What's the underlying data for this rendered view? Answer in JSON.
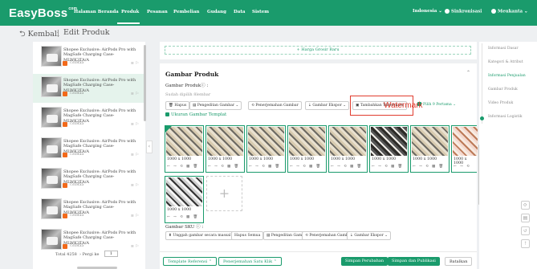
{
  "topnav": {
    "logo": "EasyBoss",
    "logo_sup": "com",
    "items": [
      "Halaman Beranda",
      "Produk",
      "Pesanan",
      "Pembelian",
      "Gudang",
      "Data",
      "Sistem"
    ],
    "language": "Indonesia",
    "sync": "Sinkronisasi",
    "user": "Meukanta"
  },
  "header": {
    "back_label": "Kembali",
    "title": "Edit Produk"
  },
  "product_list": {
    "items": [
      {
        "name": "Shopee Exclusive: AirPods Pro with MagSafe Charging Case-MLWK3TA/A",
        "code": "731855"
      },
      {
        "name": "Shopee Exclusive: AirPods Pro with MagSafe Charging Case-MLWK3TA/A",
        "code": "731855"
      },
      {
        "name": "Shopee Exclusive: AirPods Pro with MagSafe Charging Case-MLWK3TA/A",
        "code": "731855"
      },
      {
        "name": "Shopee Exclusive: AirPods Pro with MagSafe Charging Case-MLWK3TA/A",
        "code": "731855"
      },
      {
        "name": "Shopee Exclusive: AirPods Pro with MagSafe Charging Case-MLWK3TA/A",
        "code": "731855"
      },
      {
        "name": "Shopee Exclusive: AirPods Pro with MagSafe Charging Case-MLWK3TA/A",
        "code": "731855"
      },
      {
        "name": "Shopee Exclusive: AirPods Pro with MagSafe Charging Case-MLWK3TA/A",
        "code": "731855"
      }
    ],
    "total": "Total 4258",
    "goto": "Pergi ke",
    "page": "1"
  },
  "variant": {
    "add_label": "+ Harga Grosir Baru"
  },
  "images_section": {
    "title": "Gambar Produk",
    "product_images_label": "Gambar Produkⓘ :",
    "hint": "Sudah dipilih 8lembar",
    "toolbar": [
      "Hapus",
      "Pengeditan Gambar",
      "Penerjemahan Gambar",
      "Gambar Ekspor",
      "Tambahkan Watermark",
      "Pilih 9 Pertama"
    ],
    "watermark_text": "Watermark",
    "template_size": "Ukuran Gambar Templat",
    "thumbs": [
      {
        "size": "1000 x 1000"
      },
      {
        "size": "1000 x 1000"
      },
      {
        "size": "1000 x 1000"
      },
      {
        "size": "1000 x 1000"
      },
      {
        "size": "1000 x 1000"
      },
      {
        "size": "1000 x 1000"
      },
      {
        "size": "1000 x 1000"
      },
      {
        "size": "1000 x 1000"
      },
      {
        "size": "1000 x 1000"
      }
    ],
    "add_icon": "+",
    "sku_label": "Gambar SKU ⓘ :",
    "sku_toolbar": [
      "Unggah gambar secara massal",
      "Hapus Semua",
      "Pengeditan Gambar",
      "Penerjemahan Gambar",
      "Gambar Ekspor"
    ]
  },
  "side_nav": {
    "items": [
      "Informasi Dasar",
      "Kategori & Atribut",
      "Informasi Penjualan",
      "Gambar Produk",
      "Video Produk",
      "Informasi Logistik"
    ],
    "active_index": 2
  },
  "bottom": {
    "template_ref": "Template Referensi",
    "one_click": "Penerjemahan Satu Klik",
    "save": "Simpan Perubahan",
    "save_publish": "Simpan dan Publikasi",
    "cancel": "Batalkan"
  },
  "colors": {
    "brand": "#1a9b6c",
    "highlight": "#e03c2e",
    "badge": "#f26a1b"
  }
}
